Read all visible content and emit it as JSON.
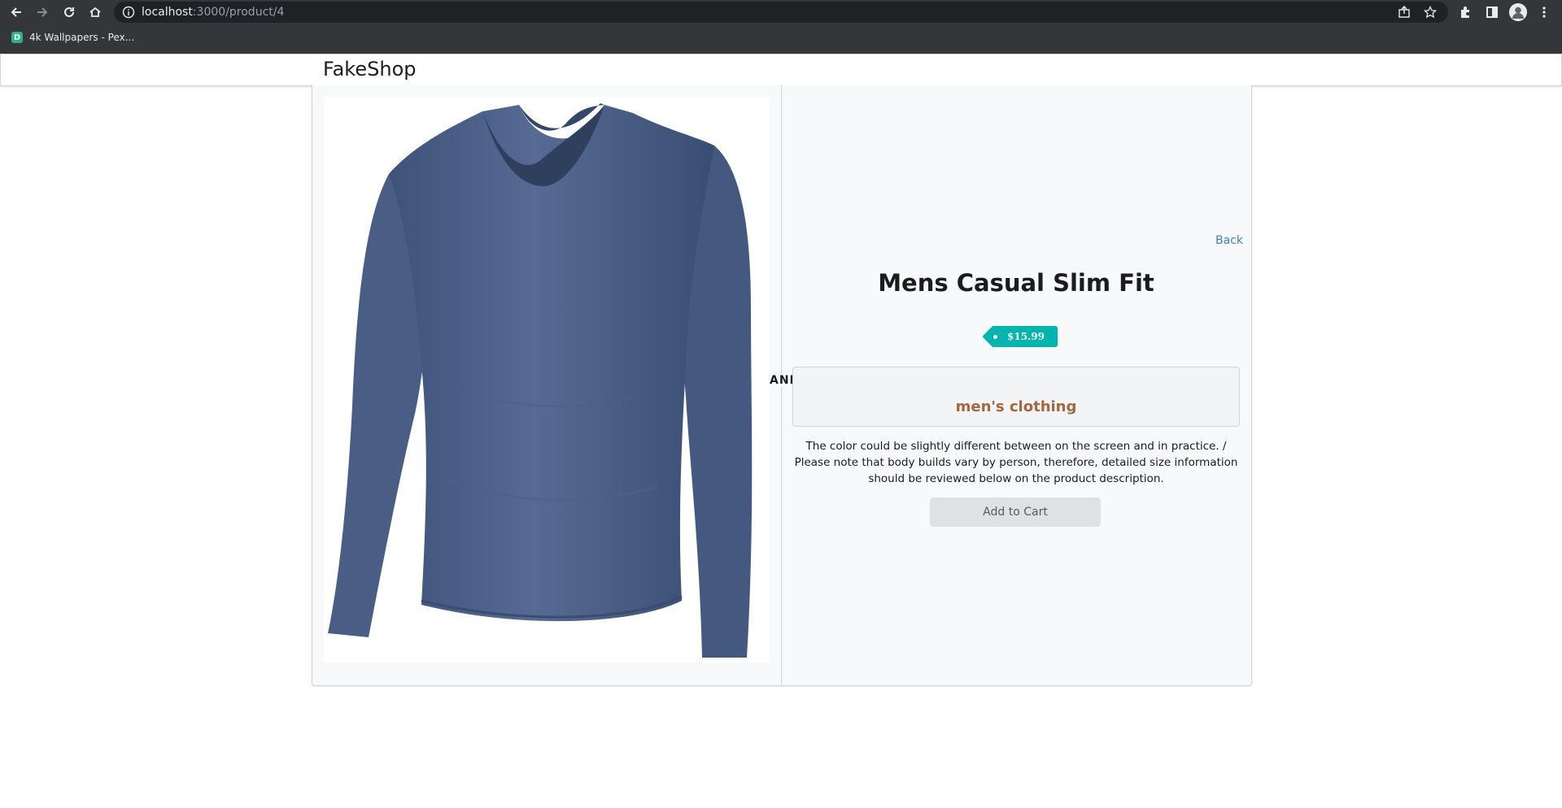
{
  "browser": {
    "url_host": "localhost",
    "url_path": ":3000/product/4",
    "bookmarks": [
      {
        "label": "4k Wallpapers - Pex...",
        "favicon_letter": "D"
      }
    ],
    "icons": [
      "back-arrow-icon",
      "forward-arrow-icon",
      "reload-icon",
      "home-icon",
      "info-icon",
      "share-icon",
      "star-icon",
      "extensions-icon",
      "sidebar-icon",
      "profile-icon",
      "menu-dots-icon"
    ]
  },
  "header": {
    "brand": "FakeShop"
  },
  "product": {
    "title": "Mens Casual Slim Fit",
    "price": "$15.99",
    "divider_label": "AND",
    "category": "men's clothing",
    "description": "The color could be slightly different between on the screen and in practice. / Please note that body builds vary by person, therefore, detailed size information should be reviewed below on the product description.",
    "add_to_cart_label": "Add to Cart",
    "back_label": "Back",
    "image_alt": "blue long sleeve v-neck t-shirt"
  },
  "colors": {
    "price_tag": "#00b5ad",
    "category_text": "#a5673f",
    "link": "#4183c4",
    "shirt": "#4a5f86"
  }
}
